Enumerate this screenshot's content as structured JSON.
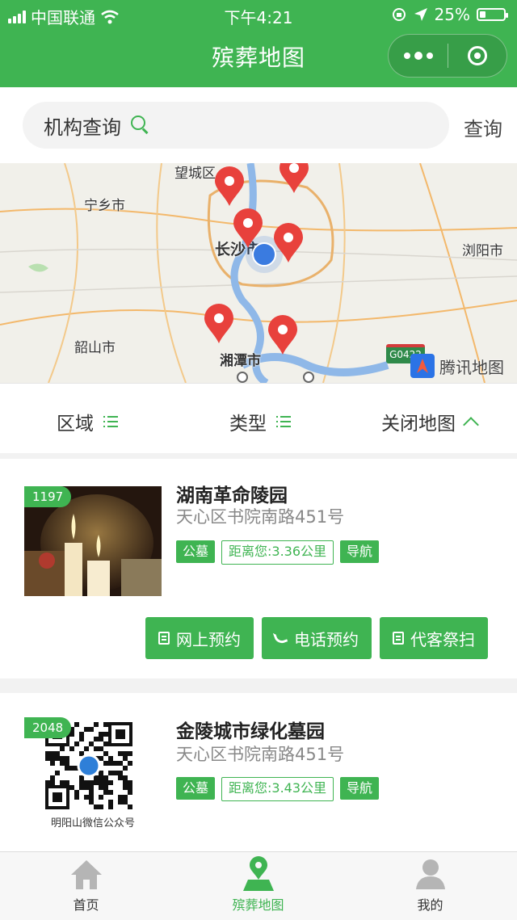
{
  "status_bar": {
    "carrier": "中国联通",
    "time": "下午4:21",
    "battery": "25%",
    "battery_level": 0.25,
    "icons": [
      "signal-icon",
      "wifi-icon",
      "orientation-lock-icon",
      "location-arrow-icon",
      "battery-icon"
    ]
  },
  "header": {
    "title": "殡葬地图",
    "capsule": {
      "menu_icon": "more-dots-icon",
      "close_icon": "target-icon"
    }
  },
  "search": {
    "placeholder": "机构查询",
    "icon": "search-icon",
    "button": "查询"
  },
  "map": {
    "labels": [
      "望城区",
      "宁乡市",
      "长沙市",
      "浏阳市",
      "韶山市",
      "湘潭市"
    ],
    "road_shield": "G0422",
    "provider": "腾讯地图",
    "marker_count": 7
  },
  "filters": {
    "region": "区域",
    "type": "类型",
    "close_map": "关闭地图"
  },
  "listings": [
    {
      "badge": "1197",
      "name": "湖南革命陵园",
      "address": "天心区书院南路451号",
      "tags": {
        "category": "公墓",
        "distance": "距离您:3.36公里",
        "navigate": "导航"
      },
      "actions": {
        "online": "网上预约",
        "phone": "电话预约",
        "proxy": "代客祭扫"
      }
    },
    {
      "badge": "2048",
      "name": "金陵城市绿化墓园",
      "address": "天心区书院南路451号",
      "image_caption": "明阳山微信公众号",
      "tags": {
        "category": "公墓",
        "distance": "距离您:3.43公里",
        "navigate": "导航"
      }
    }
  ],
  "tabbar": {
    "items": [
      {
        "label": "首页",
        "icon": "home-icon"
      },
      {
        "label": "殡葬地图",
        "icon": "map-icon"
      },
      {
        "label": "我的",
        "icon": "user-icon"
      }
    ],
    "active_color": "#3fb452",
    "inactive_color": "#333333"
  },
  "colors": {
    "brand": "#3fb452",
    "marker": "#e8413c",
    "location_dot": "#3a7be0"
  }
}
